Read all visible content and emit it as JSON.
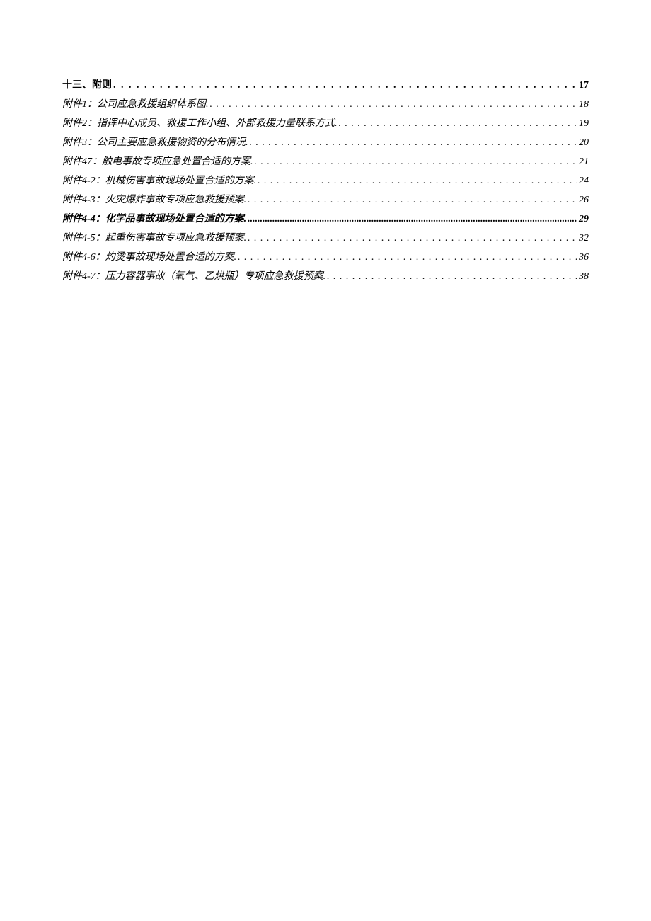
{
  "toc": {
    "entries": [
      {
        "label": "十三、附则",
        "page": "17",
        "bold": true,
        "italic": false,
        "indent": false,
        "boldDots": false
      },
      {
        "label": "附件1：公司应急救援组织体系图.",
        "page": "18",
        "bold": false,
        "italic": true,
        "indent": true,
        "boldDots": false
      },
      {
        "label": "附件2：指挥中心成员、救援工作小组、外部救援力量联系方式.",
        "page": "19",
        "bold": false,
        "italic": true,
        "indent": true,
        "boldDots": false
      },
      {
        "label": "附件3：公司主要应急救援物资的分布情况.",
        "page": "20",
        "bold": false,
        "italic": true,
        "indent": true,
        "boldDots": false
      },
      {
        "label": "附件47：触电事故专项应急处置合适的方案.",
        "page": "21",
        "bold": false,
        "italic": true,
        "indent": true,
        "boldDots": false
      },
      {
        "label": "附件4-2：机械伤害事故现场处置合适的方案.",
        "page": "24",
        "bold": false,
        "italic": true,
        "indent": true,
        "boldDots": false
      },
      {
        "label": "附件4-3：火灾爆炸事故专项应急救援预案.",
        "page": "26",
        "bold": false,
        "italic": true,
        "indent": true,
        "boldDots": false
      },
      {
        "label": "附件4-4：化学品事故现场处置合适的方案.",
        "page": "29",
        "bold": true,
        "italic": true,
        "indent": true,
        "boldDots": true
      },
      {
        "label": "附件4-5：起重伤害事故专项应急救援预案.",
        "page": "32",
        "bold": false,
        "italic": true,
        "indent": true,
        "boldDots": false
      },
      {
        "label": "附件4-6：灼烫事故现场处置合适的方案.",
        "page": "36",
        "bold": false,
        "italic": true,
        "indent": true,
        "boldDots": false
      },
      {
        "label": "附件4-7：压力容器事故（氧气、乙烘瓶）专项应急救援预案.",
        "page": "38",
        "bold": false,
        "italic": true,
        "indent": true,
        "boldDots": false
      }
    ]
  }
}
